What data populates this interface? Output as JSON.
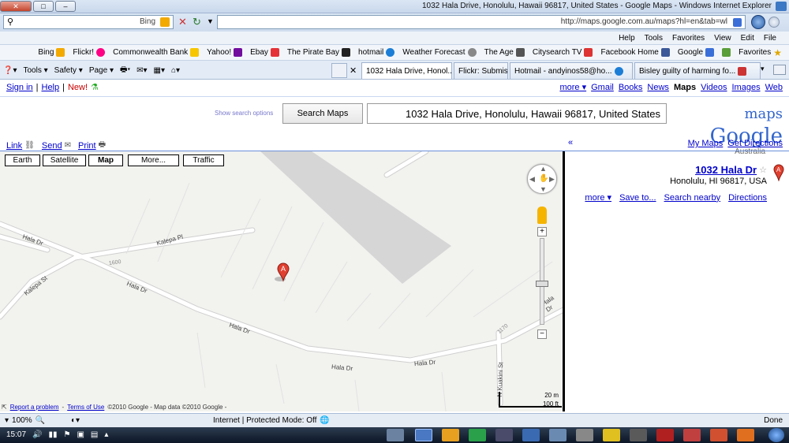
{
  "window": {
    "title": "1032 Hala Drive, Honolulu, Hawaii 96817, United States - Google Maps - Windows Internet Explorer"
  },
  "addressbar": {
    "url": "http://maps.google.com.au/maps?hl=en&tab=wl",
    "search_provider": "Bing"
  },
  "menu": [
    "File",
    "Edit",
    "View",
    "Favorites",
    "Tools",
    "Help"
  ],
  "favorites": {
    "label": "Favorites",
    "items": [
      {
        "label": "Google",
        "color": "#3b6fd8"
      },
      {
        "label": "Facebook Home",
        "color": "#3b5998"
      },
      {
        "label": "Citysearch TV",
        "color": "#d33"
      },
      {
        "label": "The Age",
        "color": "#555"
      },
      {
        "label": "Weather Forecast",
        "color": "#888"
      },
      {
        "label": "hotmail",
        "color": "#1c7ed6"
      },
      {
        "label": "The Pirate Bay",
        "color": "#222"
      },
      {
        "label": "Ebay",
        "color": "#e53238"
      },
      {
        "label": "Yahoo!",
        "color": "#720e9e"
      },
      {
        "label": "Commonwealth Bank",
        "color": "#f7c600"
      },
      {
        "label": "Flickr!",
        "color": "#ff0084"
      },
      {
        "label": "Bing",
        "color": "#f2a900"
      }
    ]
  },
  "tabs": [
    {
      "label": "Bisley guilty of harming fo...",
      "active": false
    },
    {
      "label": "Hotmail - andyinos58@ho...",
      "active": false
    },
    {
      "label": "Flickr: Submissive couple f...",
      "active": false
    },
    {
      "label": "1032 Hala Drive, Honol...",
      "active": true
    }
  ],
  "commandbar": {
    "page": "Page",
    "safety": "Safety",
    "tools": "Tools"
  },
  "google_nav": {
    "links": [
      "Web",
      "Images",
      "Videos",
      "Maps",
      "News",
      "Books",
      "Gmail",
      "more"
    ],
    "active": "Maps",
    "new": "New!",
    "help": "Help",
    "signin": "Sign in"
  },
  "logo": {
    "text": "Google",
    "product": "maps",
    "region": "Australia"
  },
  "search": {
    "value": "1032 Hala Drive, Honolulu, Hawaii 96817, United States",
    "button": "Search Maps",
    "options": "Show search options"
  },
  "toolbar": {
    "get_directions": "Get Directions",
    "my_maps": "My Maps",
    "print": "Print",
    "send": "Send",
    "link": "Link",
    "collapse": "«"
  },
  "result": {
    "title": "1032 Hala Dr",
    "address": "Honolulu, HI 96817, USA",
    "actions": [
      "Directions",
      "Search nearby",
      "Save to...",
      "more"
    ]
  },
  "map": {
    "buttons": [
      "Traffic",
      "More...",
      "Map",
      "Satellite",
      "Earth"
    ],
    "streets": [
      "Hala Dr",
      "Kalepa Pl",
      "Kalepa St",
      "Hala Dr",
      "Hala Dr",
      "Hala Dr",
      "Hala Dr",
      "N Kuakini St",
      "Hala Dr"
    ],
    "numbers": [
      "1600",
      "1170"
    ],
    "marker": "A",
    "scale": {
      "metric": "20 m",
      "imperial": "100 ft"
    },
    "copyright": "©2010 Google - Map data ©2010 Google -",
    "terms": "Terms of Use",
    "report": "Report a problem"
  },
  "statusbar": {
    "text": "Done",
    "zone": "Internet | Protected Mode: Off",
    "zoom": "100%"
  },
  "taskbar": {
    "clock": "15:07"
  }
}
